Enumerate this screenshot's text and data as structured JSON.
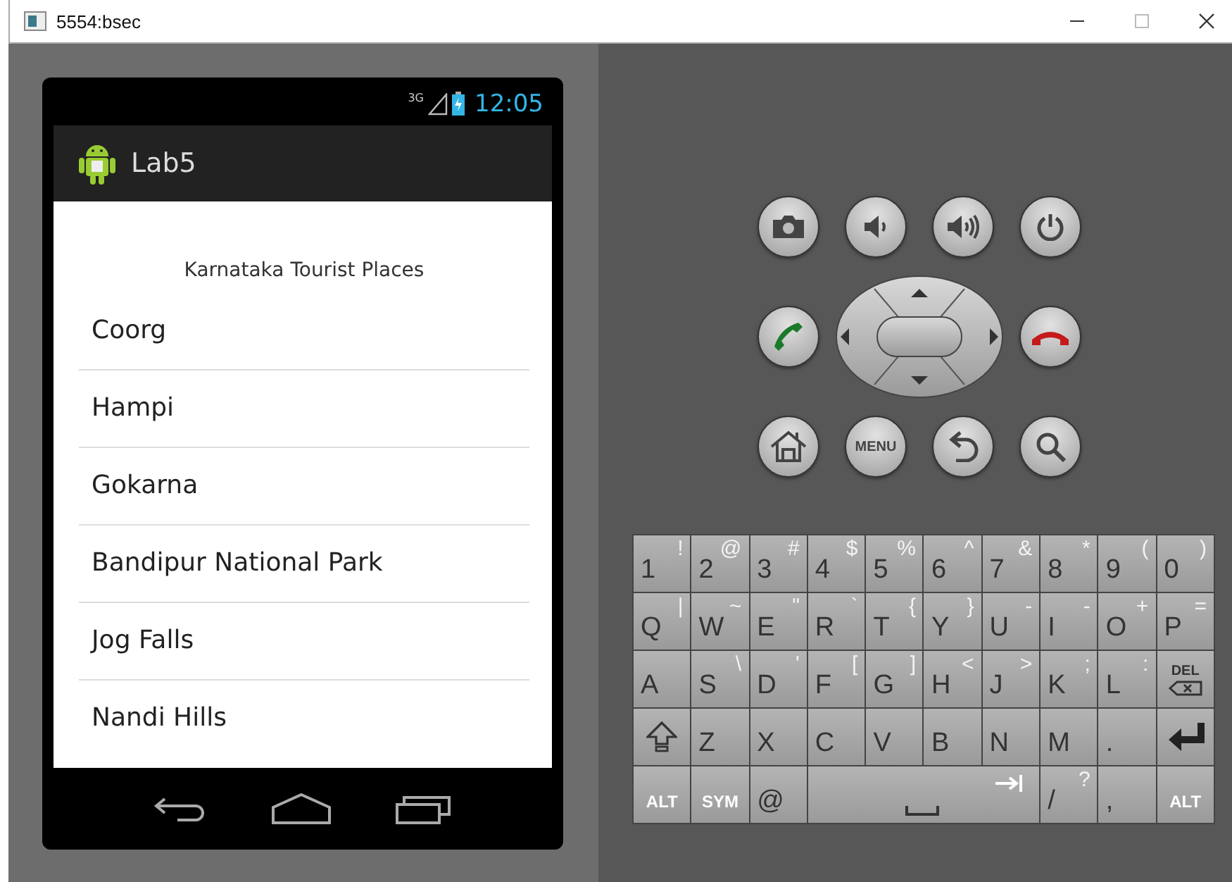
{
  "window": {
    "title": "5554:bsec"
  },
  "status_bar": {
    "network": "3G",
    "time": "12:05"
  },
  "action_bar": {
    "title": "Lab5"
  },
  "list": {
    "header": "Karnataka Tourist Places",
    "items": [
      "Coorg",
      "Hampi",
      "Gokarna",
      "Bandipur National Park",
      "Jog Falls",
      "Nandi Hills"
    ]
  },
  "hardware_buttons": [
    {
      "kind": "camera"
    },
    {
      "kind": "volume-down"
    },
    {
      "kind": "volume-up"
    },
    {
      "kind": "power"
    },
    {
      "kind": "call"
    },
    {
      "kind": "dpad"
    },
    {
      "kind": "end-call"
    },
    {
      "kind": "home"
    },
    {
      "kind": "menu",
      "label": "MENU"
    },
    {
      "kind": "back"
    },
    {
      "kind": "search"
    }
  ],
  "keyboard": {
    "rows": [
      [
        {
          "kind": "char",
          "main": "1",
          "alt": "!"
        },
        {
          "kind": "char",
          "main": "2",
          "alt": "@"
        },
        {
          "kind": "char",
          "main": "3",
          "alt": "#"
        },
        {
          "kind": "char",
          "main": "4",
          "alt": "$"
        },
        {
          "kind": "char",
          "main": "5",
          "alt": "%"
        },
        {
          "kind": "char",
          "main": "6",
          "alt": "^"
        },
        {
          "kind": "char",
          "main": "7",
          "alt": "&"
        },
        {
          "kind": "char",
          "main": "8",
          "alt": "*"
        },
        {
          "kind": "char",
          "main": "9",
          "alt": "("
        },
        {
          "kind": "char",
          "main": "0",
          "alt": ")"
        }
      ],
      [
        {
          "kind": "char",
          "main": "Q",
          "alt": "|"
        },
        {
          "kind": "char",
          "main": "W",
          "alt": "~"
        },
        {
          "kind": "char",
          "main": "E",
          "alt": "\""
        },
        {
          "kind": "char",
          "main": "R",
          "alt": "`"
        },
        {
          "kind": "char",
          "main": "T",
          "alt": "{"
        },
        {
          "kind": "char",
          "main": "Y",
          "alt": "}"
        },
        {
          "kind": "char",
          "main": "U",
          "alt": "-"
        },
        {
          "kind": "char",
          "main": "I",
          "alt": "-"
        },
        {
          "kind": "char",
          "main": "O",
          "alt": "+"
        },
        {
          "kind": "char",
          "main": "P",
          "alt": "="
        }
      ],
      [
        {
          "kind": "char",
          "main": "A"
        },
        {
          "kind": "char",
          "main": "S",
          "alt": "\\"
        },
        {
          "kind": "char",
          "main": "D",
          "alt": "'"
        },
        {
          "kind": "char",
          "main": "F",
          "alt": "["
        },
        {
          "kind": "char",
          "main": "G",
          "alt": "]"
        },
        {
          "kind": "char",
          "main": "H",
          "alt": "<"
        },
        {
          "kind": "char",
          "main": "J",
          "alt": ">"
        },
        {
          "kind": "char",
          "main": "K",
          "alt": ";"
        },
        {
          "kind": "char",
          "main": "L",
          "alt": ":"
        },
        {
          "kind": "delete",
          "label": "DEL"
        }
      ],
      [
        {
          "kind": "shift"
        },
        {
          "kind": "char",
          "main": "Z"
        },
        {
          "kind": "char",
          "main": "X"
        },
        {
          "kind": "char",
          "main": "C"
        },
        {
          "kind": "char",
          "main": "V"
        },
        {
          "kind": "char",
          "main": "B"
        },
        {
          "kind": "char",
          "main": "N"
        },
        {
          "kind": "char",
          "main": "M"
        },
        {
          "kind": "char",
          "main": "."
        },
        {
          "kind": "enter"
        }
      ]
    ],
    "bottom_row": [
      {
        "kind": "label",
        "label": "ALT"
      },
      {
        "kind": "label",
        "label": "SYM"
      },
      {
        "kind": "char",
        "main": "@"
      },
      {
        "kind": "space"
      },
      {
        "kind": "char",
        "main": "/",
        "alt": "?"
      },
      {
        "kind": "char",
        "main": ","
      },
      {
        "kind": "label",
        "label": "ALT"
      }
    ]
  }
}
